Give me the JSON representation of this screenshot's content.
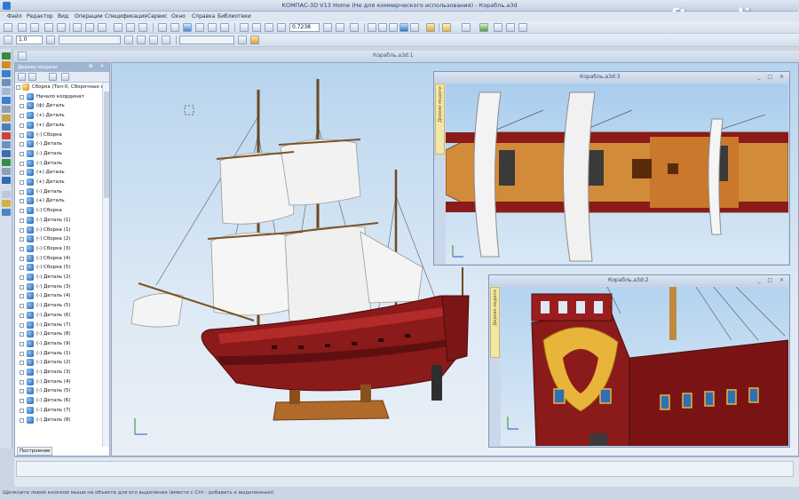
{
  "window": {
    "title": "КОМПАС-3D V13 Home (Не для коммерческого использования) - Корабль.a3d",
    "watermark": "soft.mydiv.net"
  },
  "menu": [
    "Файл",
    "Редактор",
    "Вид",
    "Операции",
    "Спецификация",
    "Сервис",
    "Окно",
    "Справка",
    "Библиотеки"
  ],
  "toolbar": {
    "zoom_value": "0.7238",
    "scale_value": "1.0"
  },
  "tree": {
    "title": "Дерево модели",
    "root": "Сборка (Тел-0, Сборочных е",
    "items": [
      "Начало координат",
      "(ф) Деталь",
      "(+) Деталь",
      "(+) Деталь",
      "(-) Сборка",
      "(-) Деталь",
      "(-) Деталь",
      "(-) Деталь",
      "(+) Деталь",
      "(+) Деталь",
      "(-) Деталь",
      "(+) Деталь",
      "(-) Сборка",
      "(-) Деталь (1)",
      "(-) Сборка (1)",
      "(-) Сборка (2)",
      "(-) Сборка (3)",
      "(-) Сборка (4)",
      "(-) Сборка (5)",
      "(-) Деталь (2)",
      "(-) Деталь (3)",
      "(-) Деталь (4)",
      "(-) Деталь (5)",
      "(-) Деталь (6)",
      "(-) Деталь (7)",
      "(-) Деталь (8)",
      "(-) Деталь (9)",
      "(-) Деталь (1)",
      "(-) Деталь (2)",
      "(-) Деталь (3)",
      "(-) Деталь (4)",
      "(-) Деталь (5)",
      "(-) Деталь (6)",
      "(-) Деталь (7)",
      "(-) Деталь (8)"
    ],
    "tab": "Построение"
  },
  "main_view": {
    "title": "Корабль.a3d:1"
  },
  "view3": {
    "title": "Корабль.a3d:3",
    "side_tab": "Дерево модели"
  },
  "view2": {
    "title": "Корабль.a3d:2",
    "side_tab": "Дерево модели"
  },
  "status": {
    "hint": "Щелкните левой кнопкой мыши на объекте для его выделения (вместе с Ctrl - добавить к выделенным)"
  }
}
